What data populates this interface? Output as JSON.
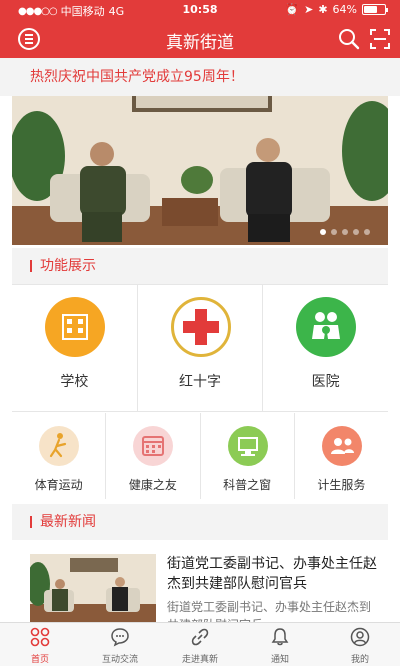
{
  "status_bar": {
    "carrier": "中国移动",
    "network": "4G",
    "time": "10:58",
    "battery": "64%",
    "battery_level": 0.64
  },
  "header": {
    "title": "真新街道"
  },
  "announcement": "热烈庆祝中国共产党成立95周年！",
  "carousel": {
    "slide_count": 5,
    "active_index": 0
  },
  "features_section": {
    "title": "功能展示",
    "top_items": [
      {
        "label": "学校",
        "icon": "building-icon",
        "color": "#f6a623"
      },
      {
        "label": "红十字",
        "icon": "red-cross-icon",
        "color": "#e23b3a"
      },
      {
        "label": "医院",
        "icon": "family-icon",
        "color": "#3cb54a"
      }
    ],
    "bottom_items": [
      {
        "label": "体育运动",
        "icon": "badminton-icon",
        "color": "#f7e3c8"
      },
      {
        "label": "健康之友",
        "icon": "calendar-icon",
        "color": "#f8d5d5"
      },
      {
        "label": "科普之窗",
        "icon": "monitor-icon",
        "color": "#8ccb55"
      },
      {
        "label": "计生服务",
        "icon": "people-icon",
        "color": "#f2866a"
      }
    ]
  },
  "news_section": {
    "title": "最新新闻",
    "items": [
      {
        "title": "街道党工委副书记、办事处主任赵杰到共建部队慰问官兵",
        "summary": "街道党工委副书记、办事处主任赵杰到共建部队慰问官兵"
      }
    ]
  },
  "tabbar": {
    "items": [
      {
        "label": "首页",
        "icon": "home-grid-icon",
        "active": true
      },
      {
        "label": "互动交流",
        "icon": "chat-icon",
        "active": false
      },
      {
        "label": "走进真新",
        "icon": "link-icon",
        "active": false
      },
      {
        "label": "通知",
        "icon": "bell-icon",
        "active": false
      },
      {
        "label": "我的",
        "icon": "user-icon",
        "active": false
      }
    ]
  },
  "colors": {
    "primary": "#e23b3a",
    "section_bg": "#f3f3f3"
  }
}
